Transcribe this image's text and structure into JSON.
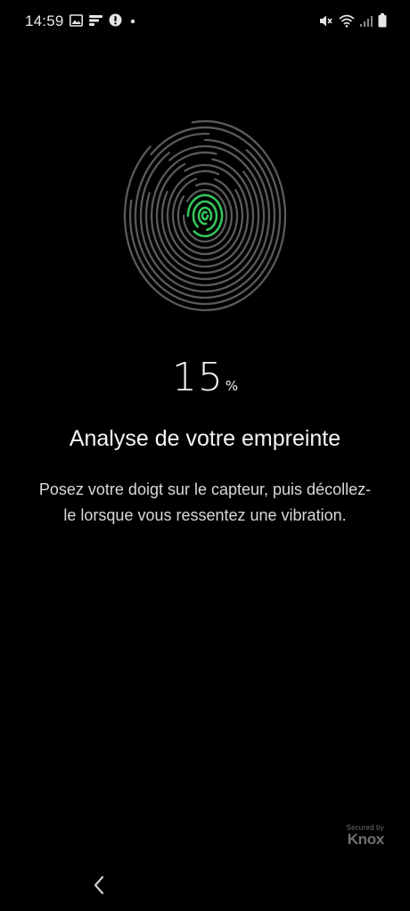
{
  "status_bar": {
    "time": "14:59",
    "left_icons": [
      "gallery-icon",
      "notification-lines-icon",
      "alert-circle-icon",
      "dot-icon"
    ],
    "right_icons": [
      "mute-icon",
      "wifi-icon",
      "signal-icon",
      "battery-icon"
    ]
  },
  "fingerprint": {
    "ring_color": "#5a5a5a",
    "active_color": "#35c45a"
  },
  "progress": {
    "value": "15",
    "unit": "%"
  },
  "title": "Analyse de votre empreinte",
  "description": "Posez votre doigt sur le capteur, puis décollez-le lorsque vous ressentez une vibration.",
  "knox": {
    "secured_by": "Secured by",
    "name": "Knox"
  },
  "navigation": {
    "back_icon": "chevron-left-icon"
  }
}
